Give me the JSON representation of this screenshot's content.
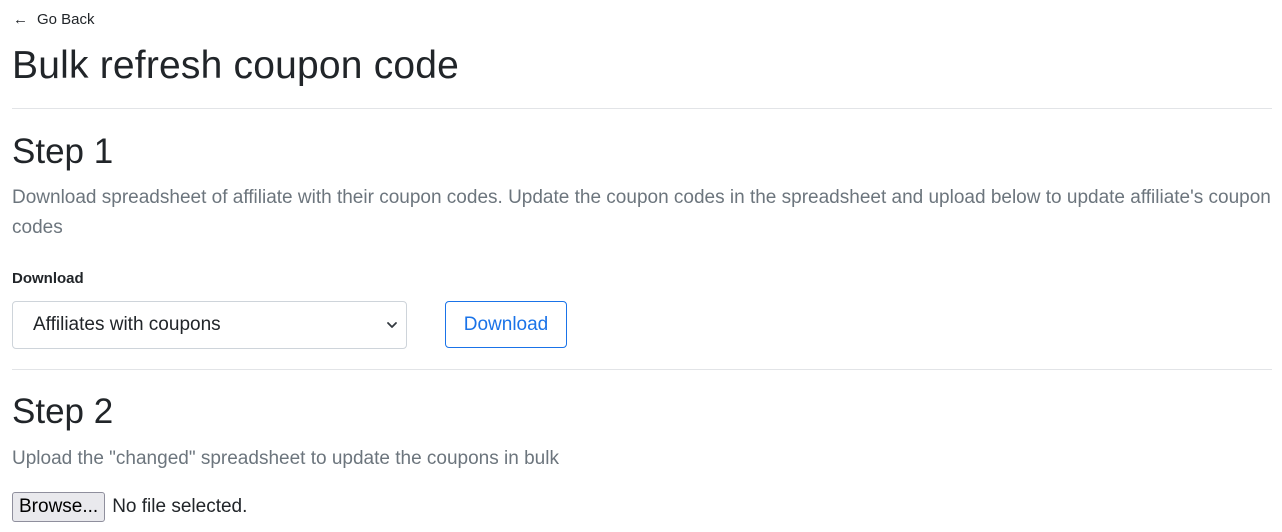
{
  "nav": {
    "go_back_label": "Go Back",
    "back_icon": "arrow-left-icon"
  },
  "page": {
    "title": "Bulk refresh coupon code"
  },
  "step1": {
    "title": "Step 1",
    "description": "Download spreadsheet of affiliate with their coupon codes. Update the coupon codes in the spreadsheet and upload below to update affiliate's coupon codes",
    "download_label": "Download",
    "select": {
      "selected_value": "Affiliates with coupons",
      "icon": "chevron-down-icon"
    },
    "download_button_label": "Download"
  },
  "step2": {
    "title": "Step 2",
    "description": "Upload the \"changed\" spreadsheet to update the coupons in bulk",
    "browse_button_label": "Browse...",
    "file_status": "No file selected."
  },
  "colors": {
    "text": "#212529",
    "muted": "#6c757d",
    "accent": "#1a73e8",
    "border": "#ced4da"
  }
}
